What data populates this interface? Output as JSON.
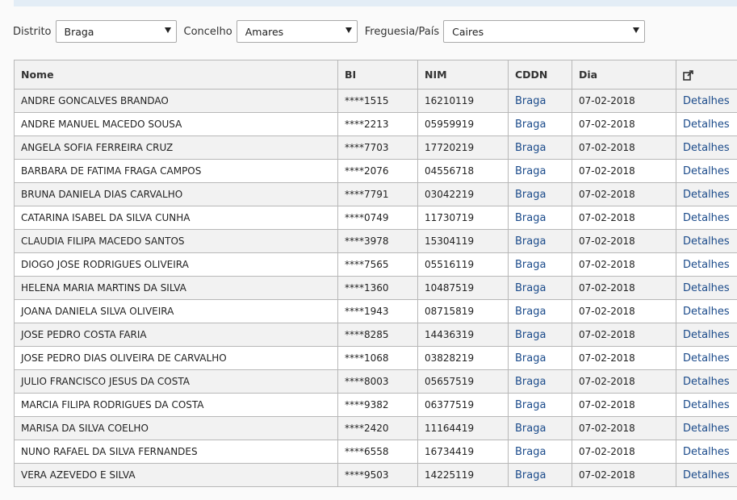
{
  "filters": {
    "distrito_label": "Distrito",
    "distrito_value": "Braga",
    "concelho_label": "Concelho",
    "concelho_value": "Amares",
    "freguesia_label": "Freguesia/País",
    "freguesia_value": "Caires"
  },
  "table": {
    "headers": {
      "nome": "Nome",
      "bi": "BI",
      "nim": "NIM",
      "cddn": "CDDN",
      "dia": "Dia"
    },
    "rows": [
      {
        "nome": "ANDRE GONCALVES BRANDAO",
        "bi": "****1515",
        "nim": "16210119",
        "cddn": "Braga",
        "dia": "07-02-2018",
        "action": "Detalhes"
      },
      {
        "nome": "ANDRE MANUEL MACEDO SOUSA",
        "bi": "****2213",
        "nim": "05959919",
        "cddn": "Braga",
        "dia": "07-02-2018",
        "action": "Detalhes"
      },
      {
        "nome": "ANGELA SOFIA FERREIRA CRUZ",
        "bi": "****7703",
        "nim": "17720219",
        "cddn": "Braga",
        "dia": "07-02-2018",
        "action": "Detalhes"
      },
      {
        "nome": "BARBARA DE FATIMA FRAGA CAMPOS",
        "bi": "****2076",
        "nim": "04556718",
        "cddn": "Braga",
        "dia": "07-02-2018",
        "action": "Detalhes"
      },
      {
        "nome": "BRUNA DANIELA DIAS CARVALHO",
        "bi": "****7791",
        "nim": "03042219",
        "cddn": "Braga",
        "dia": "07-02-2018",
        "action": "Detalhes"
      },
      {
        "nome": "CATARINA ISABEL DA SILVA CUNHA",
        "bi": "****0749",
        "nim": "11730719",
        "cddn": "Braga",
        "dia": "07-02-2018",
        "action": "Detalhes"
      },
      {
        "nome": "CLAUDIA FILIPA MACEDO SANTOS",
        "bi": "****3978",
        "nim": "15304119",
        "cddn": "Braga",
        "dia": "07-02-2018",
        "action": "Detalhes"
      },
      {
        "nome": "DIOGO JOSE RODRIGUES OLIVEIRA",
        "bi": "****7565",
        "nim": "05516119",
        "cddn": "Braga",
        "dia": "07-02-2018",
        "action": "Detalhes"
      },
      {
        "nome": "HELENA MARIA MARTINS DA SILVA",
        "bi": "****1360",
        "nim": "10487519",
        "cddn": "Braga",
        "dia": "07-02-2018",
        "action": "Detalhes"
      },
      {
        "nome": "JOANA DANIELA SILVA OLIVEIRA",
        "bi": "****1943",
        "nim": "08715819",
        "cddn": "Braga",
        "dia": "07-02-2018",
        "action": "Detalhes"
      },
      {
        "nome": "JOSE PEDRO COSTA FARIA",
        "bi": "****8285",
        "nim": "14436319",
        "cddn": "Braga",
        "dia": "07-02-2018",
        "action": "Detalhes"
      },
      {
        "nome": "JOSE PEDRO DIAS OLIVEIRA DE CARVALHO",
        "bi": "****1068",
        "nim": "03828219",
        "cddn": "Braga",
        "dia": "07-02-2018",
        "action": "Detalhes"
      },
      {
        "nome": "JULIO FRANCISCO JESUS DA COSTA",
        "bi": "****8003",
        "nim": "05657519",
        "cddn": "Braga",
        "dia": "07-02-2018",
        "action": "Detalhes"
      },
      {
        "nome": "MARCIA FILIPA RODRIGUES DA COSTA",
        "bi": "****9382",
        "nim": "06377519",
        "cddn": "Braga",
        "dia": "07-02-2018",
        "action": "Detalhes"
      },
      {
        "nome": "MARISA DA SILVA COELHO",
        "bi": "****2420",
        "nim": "11164419",
        "cddn": "Braga",
        "dia": "07-02-2018",
        "action": "Detalhes"
      },
      {
        "nome": "NUNO RAFAEL DA SILVA FERNANDES",
        "bi": "****6558",
        "nim": "16734419",
        "cddn": "Braga",
        "dia": "07-02-2018",
        "action": "Detalhes"
      },
      {
        "nome": "VERA AZEVEDO E SILVA",
        "bi": "****9503",
        "nim": "14225119",
        "cddn": "Braga",
        "dia": "07-02-2018",
        "action": "Detalhes"
      }
    ]
  },
  "icons": {
    "header_action": "external-link-icon"
  },
  "colors": {
    "link": "#1a4a8a",
    "row_alt": "#f2f2f2",
    "border": "#b8b8b8"
  }
}
